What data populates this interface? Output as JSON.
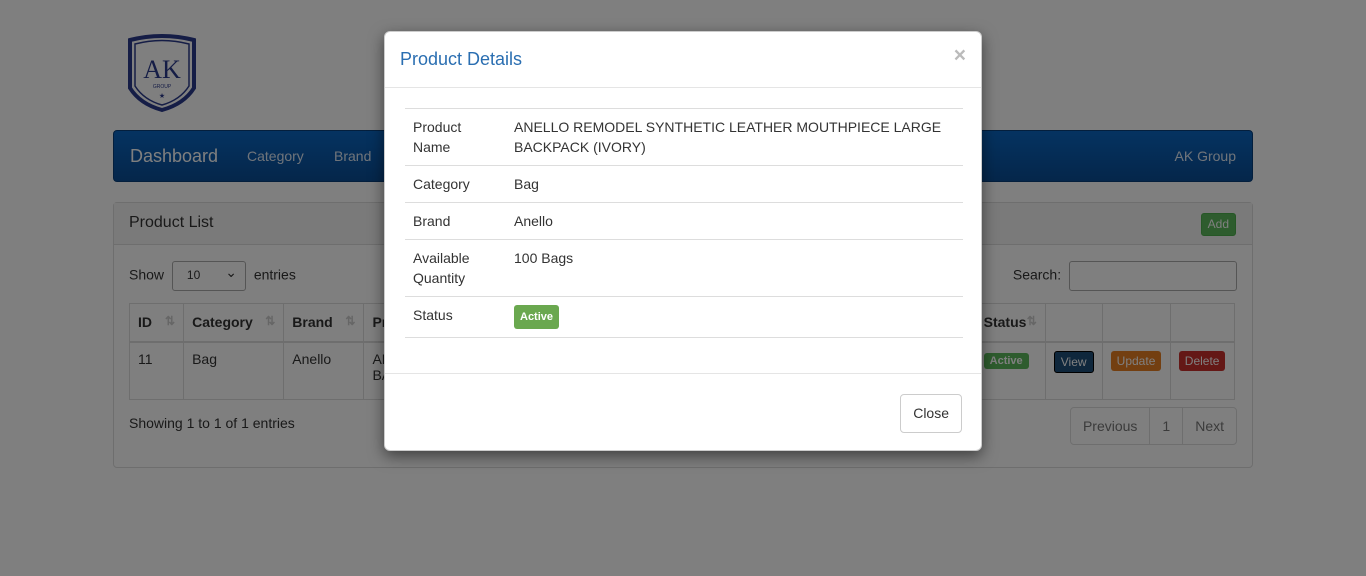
{
  "logo": {
    "letters": "AK",
    "sub": "GROUP"
  },
  "navbar": {
    "brand": "Dashboard",
    "links": [
      "Category",
      "Brand"
    ],
    "right": "AK Group"
  },
  "panel": {
    "title": "Product List",
    "add_label": "Add",
    "show_prefix": "Show",
    "show_value": "10",
    "show_suffix": "entries",
    "search_label": "Search:",
    "columns": [
      "ID",
      "Category",
      "Brand",
      "Pr",
      "Status"
    ],
    "row": {
      "id": "11",
      "category": "Bag",
      "brand": "Anello",
      "product_fragment_1": "AN",
      "product_fragment_2": "BA",
      "status": "Active",
      "view": "View",
      "update": "Update",
      "delete": "Delete"
    },
    "showing_text": "Showing 1 to 1 of 1 entries",
    "pagination": [
      "Previous",
      "1",
      "Next"
    ]
  },
  "modal": {
    "title": "Product Details",
    "close_x": "×",
    "rows": [
      {
        "label": "Product Name",
        "value": "ANELLO REMODEL SYNTHETIC LEATHER MOUTHPIECE LARGE BACKPACK (IVORY)"
      },
      {
        "label": "Category",
        "value": "Bag"
      },
      {
        "label": "Brand",
        "value": "Anello"
      },
      {
        "label": "Available Quantity",
        "value": "100 Bags"
      },
      {
        "label": "Status",
        "value": "Active"
      }
    ],
    "close_button": "Close"
  },
  "colors": {
    "navbar": "#0a58a8",
    "modal_title": "#2a6eb1",
    "success": "#5cb85c",
    "view": "#1f4e79",
    "update": "#e67e22",
    "delete": "#c9302c"
  }
}
